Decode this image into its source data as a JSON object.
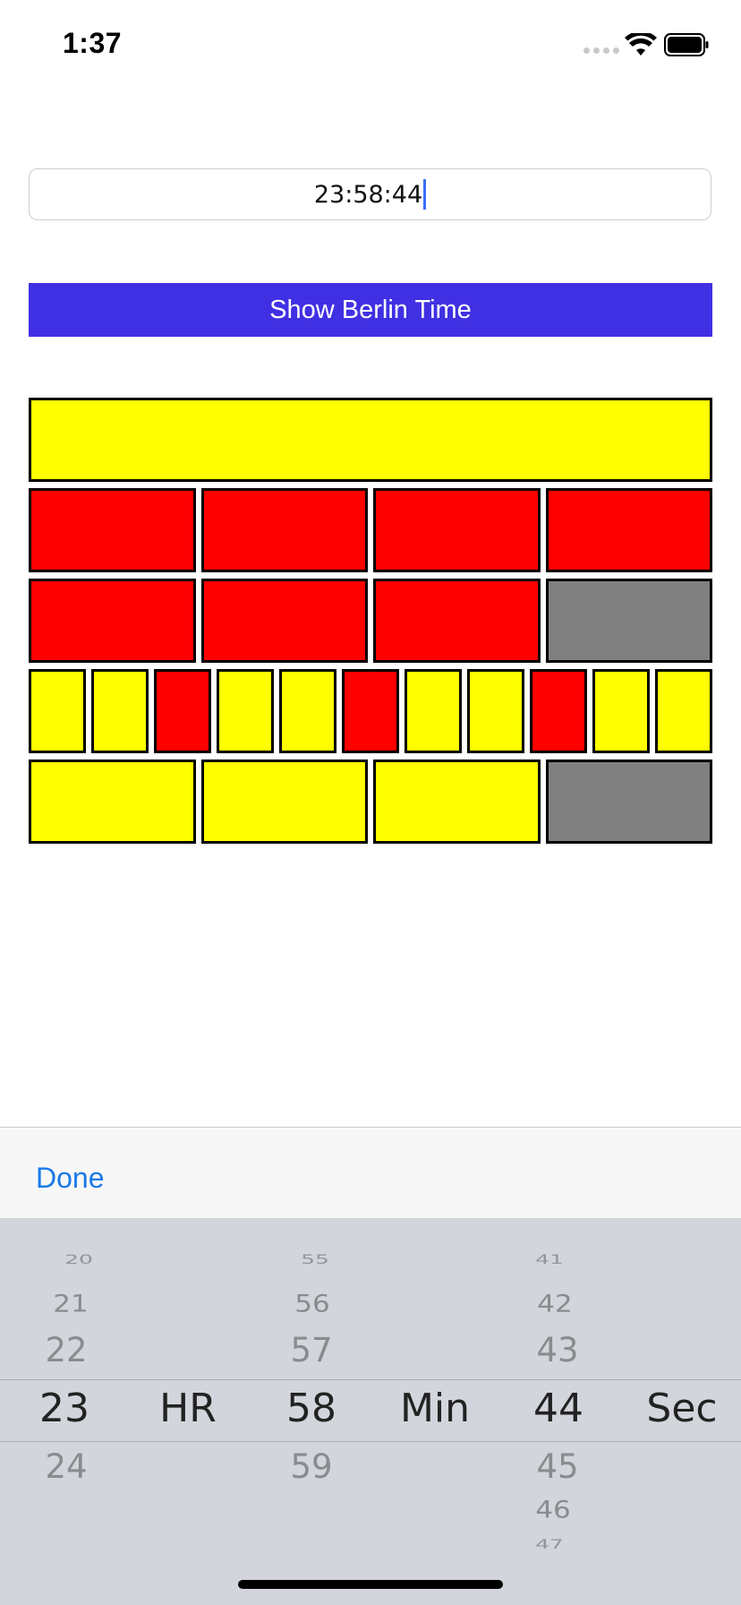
{
  "status_bar": {
    "time": "1:37"
  },
  "time_field": {
    "value": "23:58:44"
  },
  "button": {
    "label": "Show Berlin Time"
  },
  "colors": {
    "yellow": "#ffff00",
    "red": "#ff0000",
    "off": "#808080",
    "button": "#4030e3",
    "done": "#1a7ae8"
  },
  "berlin_clock": {
    "seconds_lamp": [
      "yellow"
    ],
    "five_hours": [
      "red",
      "red",
      "red",
      "red"
    ],
    "single_hours": [
      "red",
      "red",
      "red",
      "off"
    ],
    "five_minutes": [
      "yellow",
      "yellow",
      "red",
      "yellow",
      "yellow",
      "red",
      "yellow",
      "yellow",
      "red",
      "yellow",
      "yellow"
    ],
    "single_minutes": [
      "yellow",
      "yellow",
      "yellow",
      "off"
    ]
  },
  "toolbar": {
    "done_label": "Done"
  },
  "picker": {
    "hours": {
      "above": [
        "20",
        "21",
        "22"
      ],
      "selected": "23",
      "below": [
        "24"
      ],
      "label": "HR"
    },
    "minutes": {
      "above": [
        "55",
        "56",
        "57"
      ],
      "selected": "58",
      "below": [
        "59"
      ],
      "label": "Min"
    },
    "seconds": {
      "above": [
        "41",
        "42",
        "43"
      ],
      "selected": "44",
      "below": [
        "45",
        "46",
        "47"
      ],
      "label": "Sec"
    }
  }
}
